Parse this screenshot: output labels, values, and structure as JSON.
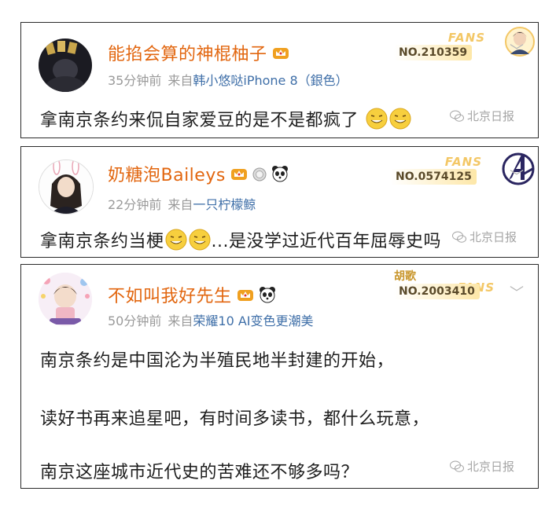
{
  "comments": [
    {
      "username": "能掐会算的神棍柚子",
      "time": "35分钟前",
      "source_prefix": "来自",
      "device": "韩小悠哒iPhone 8（銀色）",
      "text": "拿南京条约来侃自家爱豆的是不是都疯了",
      "fans_label": "FANS",
      "fans_no": "NO.210359",
      "watermark": "北京日报"
    },
    {
      "username": "奶糖泡Baileys",
      "time": "22分钟前",
      "source_prefix": "来自",
      "device": "一只柠檬鲸",
      "text_a": "拿南京条约当梗",
      "text_b": "...是没学过近代百年屈辱史吗",
      "fans_label": "FANS",
      "fans_no": "NO.0574125",
      "watermark": "北京日报"
    },
    {
      "username": "不如叫我好先生",
      "time": "50分钟前",
      "source_prefix": "来自",
      "device": "荣耀10 AI变色更潮美",
      "lines": [
        "南京条约是中国沦为半殖民地半封建的开始，",
        "读好书再来追星吧，有时间多读书，都什么玩意，",
        "南京这座城市近代史的苦难还不够多吗？"
      ],
      "fans_top": "胡歌",
      "fans_label": "FANS",
      "fans_no": "NO.2003410",
      "watermark": "北京日报"
    }
  ],
  "colors": {
    "username": "#e2660f",
    "meta": "#9a9a9a",
    "device": "#3f6fa8",
    "border": "#2a2a2a",
    "fans_gold": "#f3c766"
  },
  "icons": [
    "crown-icon",
    "medal-icon",
    "panda-icon",
    "grin-emoji-icon",
    "chevron-down-icon",
    "wechat-icon"
  ]
}
